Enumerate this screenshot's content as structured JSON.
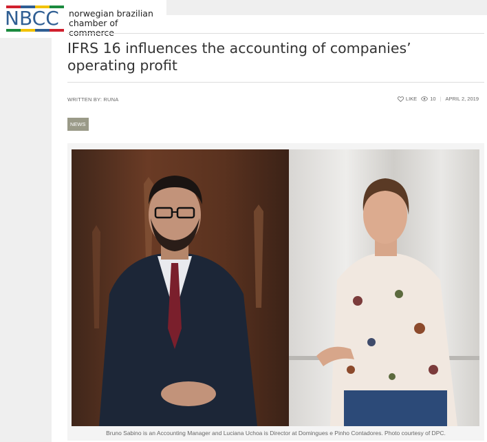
{
  "logo": {
    "mark": "NBCC",
    "line1": "norwegian brazilian",
    "line2": "chamber of commerce",
    "stripe_colors": [
      "#d0202e",
      "#2f5e93",
      "#f2c200",
      "#1b8a3e"
    ]
  },
  "article": {
    "title": "IFRS 16 influences the accounting of companies’ operating profit",
    "written_by": "WRITTEN BY: RUNA",
    "like_label": "LIKE",
    "views": "10",
    "date": "APRIL 2, 2019",
    "tag": "NEWS",
    "caption": "Bruno Sabino is an Accounting Manager and Luciana Uchoa is Director at Domingues e Pinho Contadores. Photo courtesy of DPC."
  },
  "icons": {
    "like": "heart-icon",
    "views": "eye-icon"
  }
}
